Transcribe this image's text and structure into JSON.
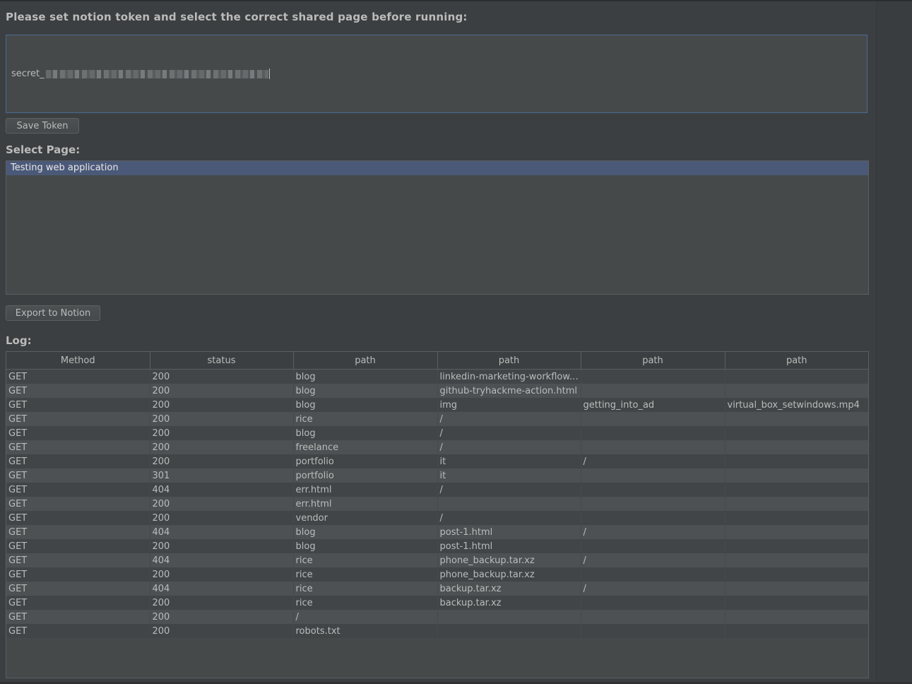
{
  "heading": "Please set notion token and select the correct shared page before running:",
  "token": {
    "visible_prefix": "secret_"
  },
  "buttons": {
    "save_token": "Save Token",
    "export": "Export to Notion"
  },
  "select_page": {
    "label": "Select Page:",
    "items": [
      {
        "label": "Testing web application",
        "selected": true
      }
    ]
  },
  "log": {
    "label": "Log:",
    "columns": [
      "Method",
      "status",
      "path",
      "path",
      "path",
      "path"
    ],
    "rows": [
      [
        "GET",
        "200",
        "blog",
        "linkedin-marketing-workflow....",
        "",
        ""
      ],
      [
        "GET",
        "200",
        "blog",
        "github-tryhackme-action.html",
        "",
        ""
      ],
      [
        "GET",
        "200",
        "blog",
        "img",
        "getting_into_ad",
        "virtual_box_setwindows.mp4"
      ],
      [
        "GET",
        "200",
        "rice",
        "/",
        "",
        ""
      ],
      [
        "GET",
        "200",
        "blog",
        "/",
        "",
        ""
      ],
      [
        "GET",
        "200",
        "freelance",
        "/",
        "",
        ""
      ],
      [
        "GET",
        "200",
        "portfolio",
        "it",
        "/",
        ""
      ],
      [
        "GET",
        "301",
        "portfolio",
        "it",
        "",
        ""
      ],
      [
        "GET",
        "404",
        "err.html",
        "/",
        "",
        ""
      ],
      [
        "GET",
        "200",
        "err.html",
        "",
        "",
        ""
      ],
      [
        "GET",
        "200",
        "vendor",
        "/",
        "",
        ""
      ],
      [
        "GET",
        "404",
        "blog",
        "post-1.html",
        "/",
        ""
      ],
      [
        "GET",
        "200",
        "blog",
        "post-1.html",
        "",
        ""
      ],
      [
        "GET",
        "404",
        "rice",
        "phone_backup.tar.xz",
        "/",
        ""
      ],
      [
        "GET",
        "200",
        "rice",
        "phone_backup.tar.xz",
        "",
        ""
      ],
      [
        "GET",
        "404",
        "rice",
        "backup.tar.xz",
        "/",
        ""
      ],
      [
        "GET",
        "200",
        "rice",
        "backup.tar.xz",
        "",
        ""
      ],
      [
        "GET",
        "200",
        "/",
        "",
        "",
        ""
      ],
      [
        "GET",
        "200",
        "robots.txt",
        "",
        "",
        ""
      ]
    ]
  },
  "colors": {
    "background": "#3c3f41",
    "field": "#45494a",
    "selection": "#4b5979",
    "focus_border": "#4b6a92",
    "text": "#bbbbbb"
  }
}
